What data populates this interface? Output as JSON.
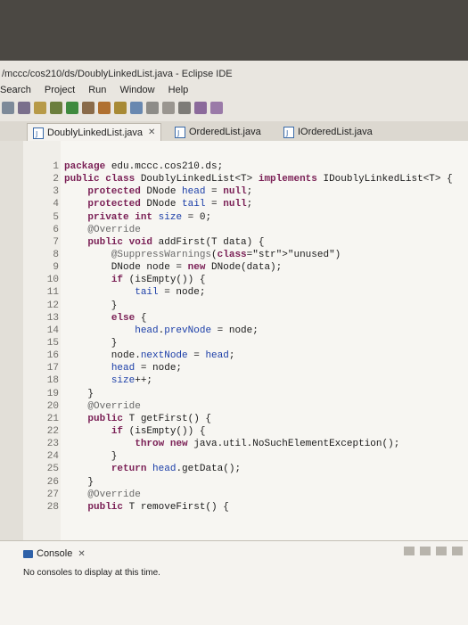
{
  "window": {
    "title": "/mccc/cos210/ds/DoublyLinkedList.java - Eclipse IDE"
  },
  "menu": [
    "Search",
    "Project",
    "Run",
    "Window",
    "Help"
  ],
  "tabs": [
    {
      "label": "DoublyLinkedList.java",
      "active": true,
      "close": "✕"
    },
    {
      "label": "OrderedList.java",
      "active": false
    },
    {
      "label": "IOrderedList.java",
      "active": false
    }
  ],
  "code_lines": [
    {
      "n": "1",
      "text": "package edu.mccc.cos210.ds;"
    },
    {
      "n": "2",
      "text": "public class DoublyLinkedList<T> implements IDoublyLinkedList<T> {"
    },
    {
      "n": "3",
      "text": "    protected DNode head = null;"
    },
    {
      "n": "4",
      "text": "    protected DNode tail = null;"
    },
    {
      "n": "5",
      "text": "    private int size = 0;"
    },
    {
      "n": "6",
      "text": "    @Override"
    },
    {
      "n": "7",
      "text": "    public void addFirst(T data) {"
    },
    {
      "n": "8",
      "text": "        @SuppressWarnings(\"unused\")"
    },
    {
      "n": "9",
      "text": "        DNode node = new DNode(data);"
    },
    {
      "n": "10",
      "text": "        if (isEmpty()) {"
    },
    {
      "n": "11",
      "text": "            tail = node;"
    },
    {
      "n": "12",
      "text": "        }"
    },
    {
      "n": "13",
      "text": "        else {"
    },
    {
      "n": "14",
      "text": "            head.prevNode = node;"
    },
    {
      "n": "15",
      "text": "        }"
    },
    {
      "n": "16",
      "text": "        node.nextNode = head;"
    },
    {
      "n": "17",
      "text": "        head = node;"
    },
    {
      "n": "18",
      "text": "        size++;"
    },
    {
      "n": "19",
      "text": "    }"
    },
    {
      "n": "20",
      "text": "    @Override"
    },
    {
      "n": "21",
      "text": "    public T getFirst() {"
    },
    {
      "n": "22",
      "text": "        if (isEmpty()) {"
    },
    {
      "n": "23",
      "text": "            throw new java.util.NoSuchElementException();"
    },
    {
      "n": "24",
      "text": "        }"
    },
    {
      "n": "25",
      "text": "        return head.getData();"
    },
    {
      "n": "26",
      "text": "    }"
    },
    {
      "n": "27",
      "text": "    @Override"
    },
    {
      "n": "28",
      "text": "    public T removeFirst() {"
    }
  ],
  "console": {
    "tab_label": "Console",
    "tab_close": "✕",
    "message": "No consoles to display at this time."
  },
  "colors": {
    "keyword": "#7a1f55",
    "string": "#2a2fb0",
    "background": "#f7f6f2"
  }
}
